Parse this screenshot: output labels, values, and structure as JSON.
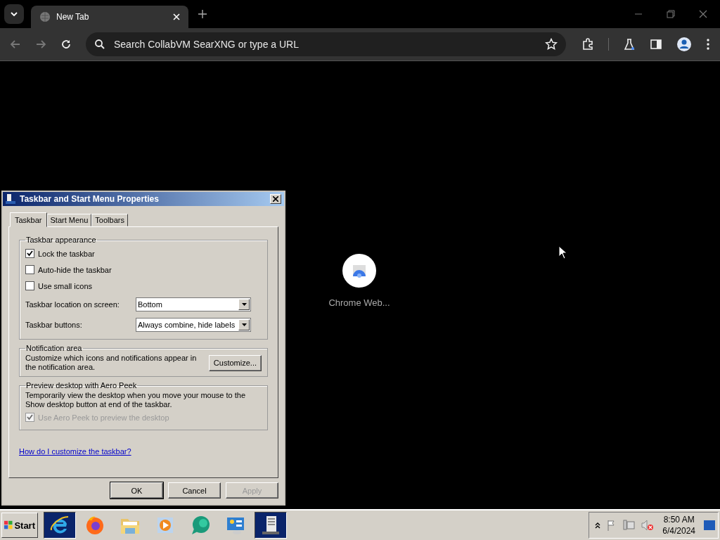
{
  "browser": {
    "tabs": [
      {
        "title": "New Tab",
        "selected": true
      }
    ],
    "address_placeholder": "Search CollabVM SearXNG or type a URL",
    "shortcuts": [
      {
        "label": "Chrome Web..."
      }
    ]
  },
  "dialog": {
    "title": "Taskbar and Start Menu Properties",
    "tabs": [
      {
        "label": "Taskbar",
        "selected": true
      },
      {
        "label": "Start Menu",
        "selected": false
      },
      {
        "label": "Toolbars",
        "selected": false
      }
    ],
    "taskbar_appearance": {
      "legend": "Taskbar appearance",
      "checkboxes": [
        {
          "label": "Lock the taskbar",
          "checked": true
        },
        {
          "label": "Auto-hide the taskbar",
          "checked": false
        },
        {
          "label": "Use small icons",
          "checked": false
        }
      ],
      "dropdowns": [
        {
          "label": "Taskbar location on screen:",
          "value": "Bottom"
        },
        {
          "label": "Taskbar buttons:",
          "value": "Always combine, hide labels"
        }
      ]
    },
    "notification_area": {
      "legend": "Notification area",
      "text": "Customize which icons and notifications appear in the notification area.",
      "button": "Customize..."
    },
    "aero_peek": {
      "legend": "Preview desktop with Aero Peek",
      "text": "Temporarily view the desktop when you move your mouse to the Show desktop button at end of the taskbar.",
      "checkbox": {
        "label": "Use Aero Peek to preview the desktop",
        "checked": true,
        "disabled": true
      }
    },
    "help_link": "How do I customize the taskbar?",
    "buttons": [
      {
        "label": "OK",
        "disabled": false
      },
      {
        "label": "Cancel",
        "disabled": false
      },
      {
        "label": "Apply",
        "disabled": true
      }
    ]
  },
  "taskbar": {
    "start": "Start",
    "apps": [
      {
        "kind": "ie",
        "selected": true
      },
      {
        "kind": "firefox",
        "selected": false
      },
      {
        "kind": "folder",
        "selected": false
      },
      {
        "kind": "media",
        "selected": false
      },
      {
        "kind": "chat",
        "selected": false
      },
      {
        "kind": "control",
        "selected": false
      },
      {
        "kind": "server",
        "selected": true
      }
    ],
    "time": "8:50 AM",
    "date": "6/4/2024"
  }
}
